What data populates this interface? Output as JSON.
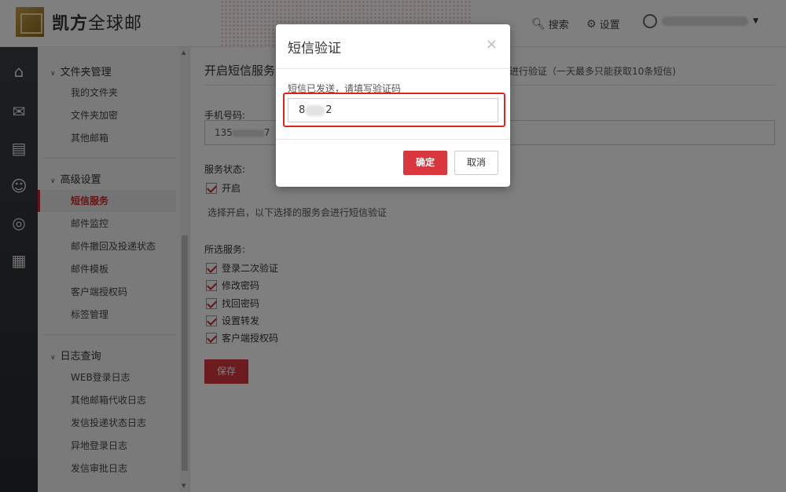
{
  "header": {
    "brand": "凯方",
    "brand_suffix": "全球邮",
    "search_label": "搜索",
    "settings_label": "设置"
  },
  "rail": {
    "icons": [
      "home-icon",
      "mail-icon",
      "contacts-icon",
      "add-user-icon",
      "lifebuoy-icon",
      "calendar-icon"
    ]
  },
  "sidebar": {
    "group_folders": "文件夹管理",
    "folders_items": [
      "我的文件夹",
      "文件夹加密",
      "其他邮箱"
    ],
    "group_advanced": "高级设置",
    "advanced_items": [
      "短信服务",
      "邮件监控",
      "邮件撤回及投递状态",
      "邮件模板",
      "客户端授权码",
      "标签管理"
    ],
    "group_logs": "日志查询",
    "logs_items": [
      "WEB登录日志",
      "其他邮箱代收日志",
      "发信投递状态日志",
      "异地登录日志",
      "发信审批日志"
    ]
  },
  "main": {
    "title": "开启短信服务",
    "note": "进行验证（一天最多只能获取10条短信)",
    "phone_label": "手机号码:",
    "phone_prefix": "135",
    "phone_suffix": "7",
    "status_label": "服务状态:",
    "status_option": "开启",
    "help_text": "选择开启，以下选择的服务会进行短信验证",
    "services_label": "所选服务:",
    "services": [
      "登录二次验证",
      "修改密码",
      "找回密码",
      "设置转发",
      "客户端授权码"
    ],
    "save_label": "保存"
  },
  "modal": {
    "title": "短信验证",
    "close": "×",
    "message": "短信已发送，请填写验证码",
    "code_prefix": "8",
    "code_suffix": "2",
    "ok_label": "确定",
    "cancel_label": "取消"
  },
  "colors": {
    "accent": "#d9363e",
    "highlight": "#e0241e"
  }
}
